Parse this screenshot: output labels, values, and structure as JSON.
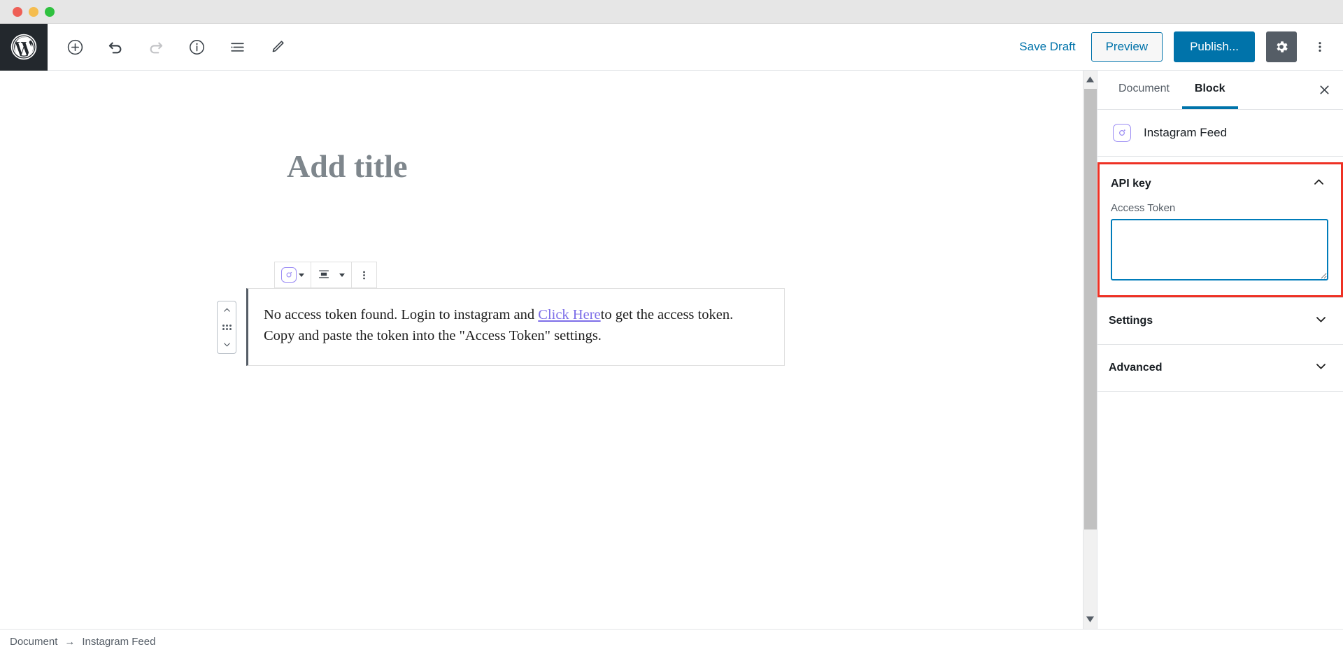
{
  "window": {
    "traffic_lights": [
      "close",
      "minimize",
      "maximize"
    ]
  },
  "topbar": {
    "logo": "wordpress-logo",
    "left_tools": [
      {
        "name": "add-block-button",
        "icon": "plus-circle-icon",
        "disabled": false
      },
      {
        "name": "undo-button",
        "icon": "undo-icon",
        "disabled": false
      },
      {
        "name": "redo-button",
        "icon": "redo-icon",
        "disabled": true
      },
      {
        "name": "content-info-button",
        "icon": "info-circle-icon",
        "disabled": false
      },
      {
        "name": "list-view-button",
        "icon": "list-view-icon",
        "disabled": false
      },
      {
        "name": "edit-mode-button",
        "icon": "pencil-icon",
        "disabled": false
      }
    ],
    "save_draft_label": "Save Draft",
    "preview_label": "Preview",
    "publish_label": "Publish...",
    "settings_gear_icon": "gear-icon",
    "more_options_icon": "kebab-menu-icon",
    "accent_blue": "#0073aa",
    "gear_active_bg": "#555d66"
  },
  "editor": {
    "title_placeholder": "Add title",
    "block_toolbar": {
      "block_type_icon": "instagram-icon",
      "block_type_caret": "chevron-down-icon",
      "align_icon": "align-center-icon",
      "align_caret": "chevron-down-icon",
      "more_icon": "kebab-menu-icon"
    },
    "block_mover": {
      "up_icon": "chevron-up-icon",
      "drag_icon": "drag-handle-icon",
      "down_icon": "chevron-down-icon"
    },
    "block_content": {
      "text_before_link": "No access token found. Login to instagram and ",
      "link_text": "Click Here",
      "text_after_link": "to get the access token. Copy and paste the token into the \"Access Token\" settings.",
      "link_color": "#7d6ee8"
    },
    "scrollbar": {
      "up_arrow_icon": "scroll-up-arrow-icon",
      "down_arrow_icon": "scroll-down-arrow-icon"
    }
  },
  "sidebar": {
    "tabs": [
      {
        "label": "Document",
        "active": false
      },
      {
        "label": "Block",
        "active": true
      }
    ],
    "close_icon": "close-icon",
    "block_info": {
      "icon": "instagram-icon",
      "label": "Instagram Feed"
    },
    "panels": [
      {
        "title": "API key",
        "expanded": true,
        "highlight_color": "#ee3124",
        "toggle_icon": "chevron-up-icon",
        "field_label": "Access Token",
        "field_value": "",
        "field_placeholder": "",
        "field_border_color": "#007cba"
      },
      {
        "title": "Settings",
        "expanded": false,
        "toggle_icon": "chevron-down-icon"
      },
      {
        "title": "Advanced",
        "expanded": false,
        "toggle_icon": "chevron-down-icon"
      }
    ]
  },
  "footer": {
    "breadcrumb": [
      {
        "label": "Document"
      },
      {
        "label": "Instagram Feed"
      }
    ],
    "separator": "→"
  }
}
